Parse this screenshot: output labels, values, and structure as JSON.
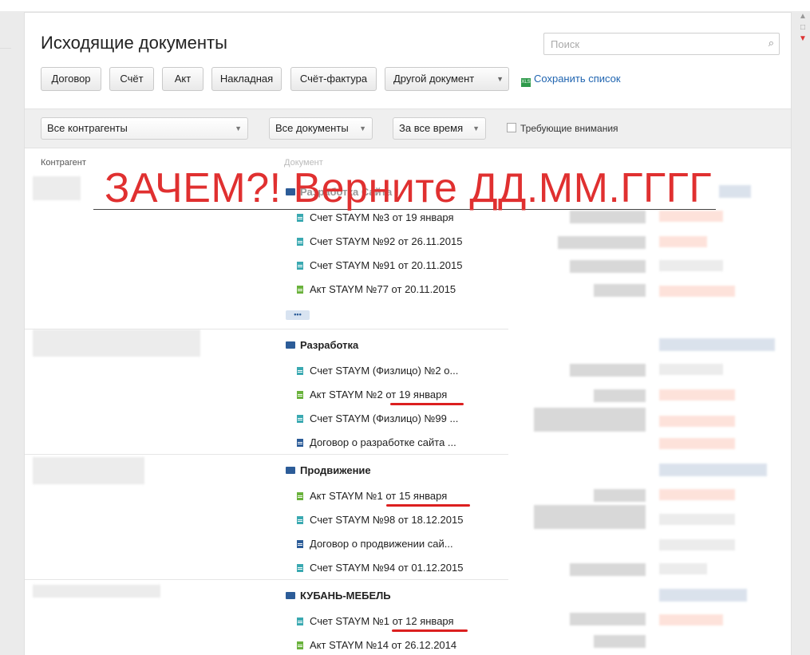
{
  "page": {
    "title": "Исходящие документы",
    "search_placeholder": "Поиск"
  },
  "toolbar": {
    "buttons": [
      "Договор",
      "Счёт",
      "Акт",
      "Накладная",
      "Счёт-фактура",
      "Другой документ"
    ],
    "save_list": "Сохранить список"
  },
  "filters": {
    "contractors": "Все контрагенты",
    "documents": "Все документы",
    "period": "За все время",
    "attention": "Требующие внимания"
  },
  "columns": {
    "contractor": "Контрагент",
    "document": "Документ"
  },
  "groups": [
    {
      "title": "Разработка Сайта",
      "docs": [
        {
          "text": "Счет STAYM №3 от 19 января",
          "icon": "teal"
        },
        {
          "text": "Счет STAYM №92 от 26.11.2015",
          "icon": "teal"
        },
        {
          "text": "Счет STAYM №91 от 20.11.2015",
          "icon": "teal"
        },
        {
          "text": "Акт STAYM №77 от 20.11.2015",
          "icon": "green"
        }
      ],
      "more": "•••"
    },
    {
      "title": "Разработка",
      "docs": [
        {
          "text": "Счет STAYM (Физлицо) №2 о...",
          "icon": "teal"
        },
        {
          "text": "Акт STAYM №2 от 19 января",
          "icon": "green"
        },
        {
          "text": "Счет STAYM (Физлицо) №99 ...",
          "icon": "teal"
        },
        {
          "text": "Договор о разработке сайта ...",
          "icon": "navy"
        }
      ]
    },
    {
      "title": "Продвижение",
      "docs": [
        {
          "text": "Акт STAYM №1 от 15 января",
          "icon": "green"
        },
        {
          "text": "Счет STAYM №98 от 18.12.2015",
          "icon": "teal"
        },
        {
          "text": "Договор о продвижении сай...",
          "icon": "navy"
        },
        {
          "text": "Счет STAYM №94 от 01.12.2015",
          "icon": "teal"
        }
      ]
    },
    {
      "title": "КУБАНЬ-МЕБЕЛЬ",
      "docs": [
        {
          "text": "Счет STAYM №1 от 12 января",
          "icon": "teal"
        },
        {
          "text": "Акт STAYM №14 от 26.12.2014",
          "icon": "green"
        }
      ]
    }
  ],
  "overlay_text": "ЗАЧЕМ?! Верните ДД.ММ.ГГГГ",
  "colors": {
    "annotation_red": "#e03030",
    "link_blue": "#1f64b0",
    "folder_navy": "#2c5c98"
  }
}
